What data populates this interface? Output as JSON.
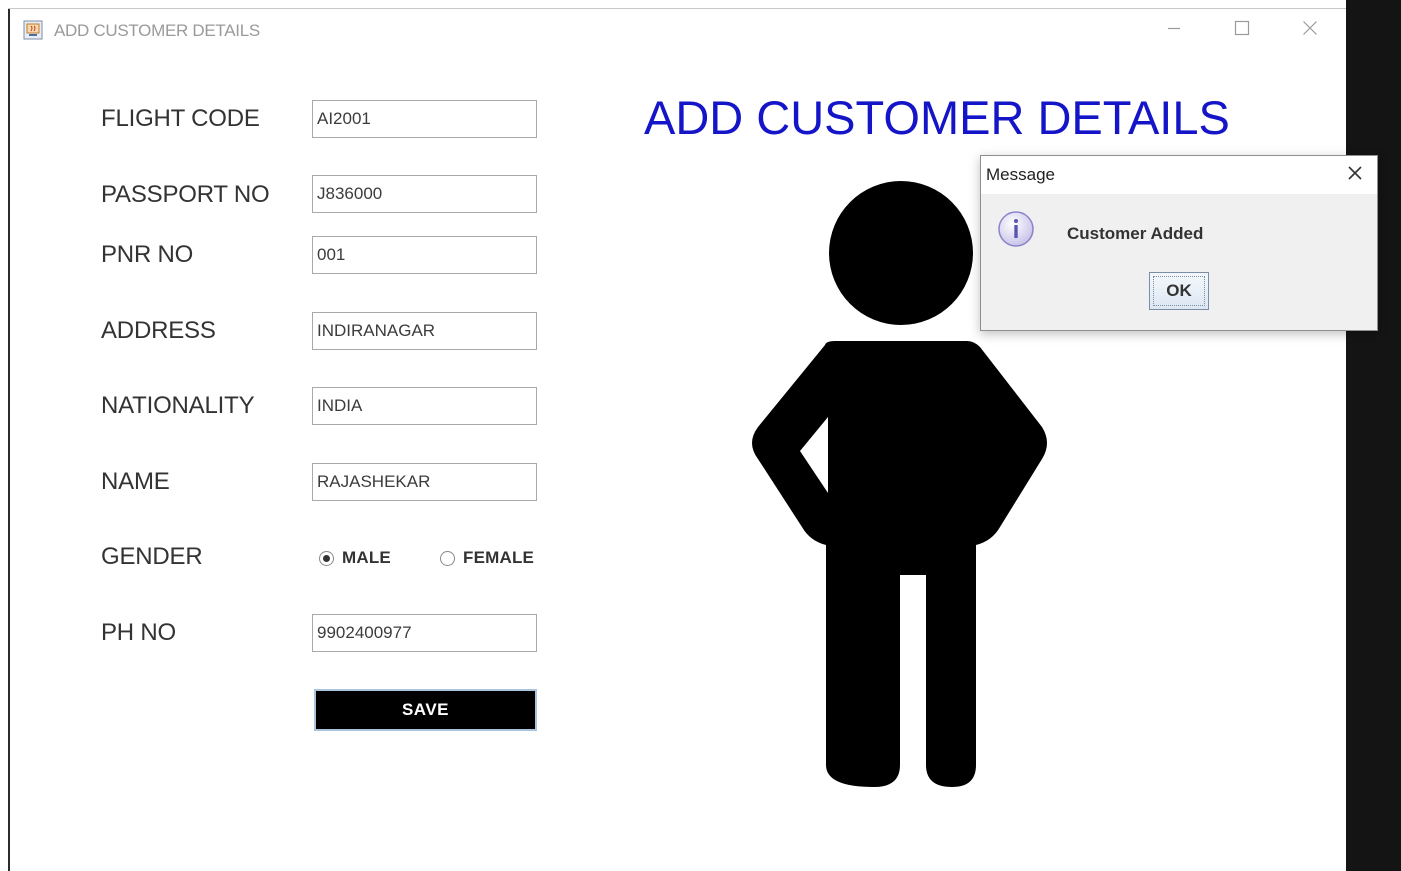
{
  "window": {
    "title": "ADD CUSTOMER DETAILS",
    "icons": {
      "app": "java-app-icon",
      "minimize": "minimize-icon",
      "maximize": "maximize-icon",
      "close": "close-icon"
    }
  },
  "heading": "ADD CUSTOMER DETAILS",
  "form": {
    "flight_code": {
      "label": "FLIGHT CODE",
      "value": "AI2001"
    },
    "passport_no": {
      "label": "PASSPORT NO",
      "value": "J836000"
    },
    "pnr_no": {
      "label": "PNR NO",
      "value": "001"
    },
    "address": {
      "label": "ADDRESS",
      "value": "INDIRANAGAR"
    },
    "nationality": {
      "label": "NATIONALITY",
      "value": "INDIA"
    },
    "name": {
      "label": "NAME",
      "value": "RAJASHEKAR"
    },
    "gender": {
      "label": "GENDER",
      "options": [
        {
          "label": "MALE",
          "selected": true
        },
        {
          "label": "FEMALE",
          "selected": false
        }
      ]
    },
    "ph_no": {
      "label": "PH NO",
      "value": "9902400977"
    },
    "save_label": "SAVE"
  },
  "illustration": {
    "icon": "person-icon"
  },
  "dialog": {
    "title": "Message",
    "icon": "info-icon",
    "message": "Customer Added",
    "ok_label": "OK"
  },
  "colors": {
    "heading": "#1414c8",
    "save_button_bg": "#000000",
    "save_button_text": "#ffffff",
    "dialog_bg": "#f0f0f0"
  }
}
